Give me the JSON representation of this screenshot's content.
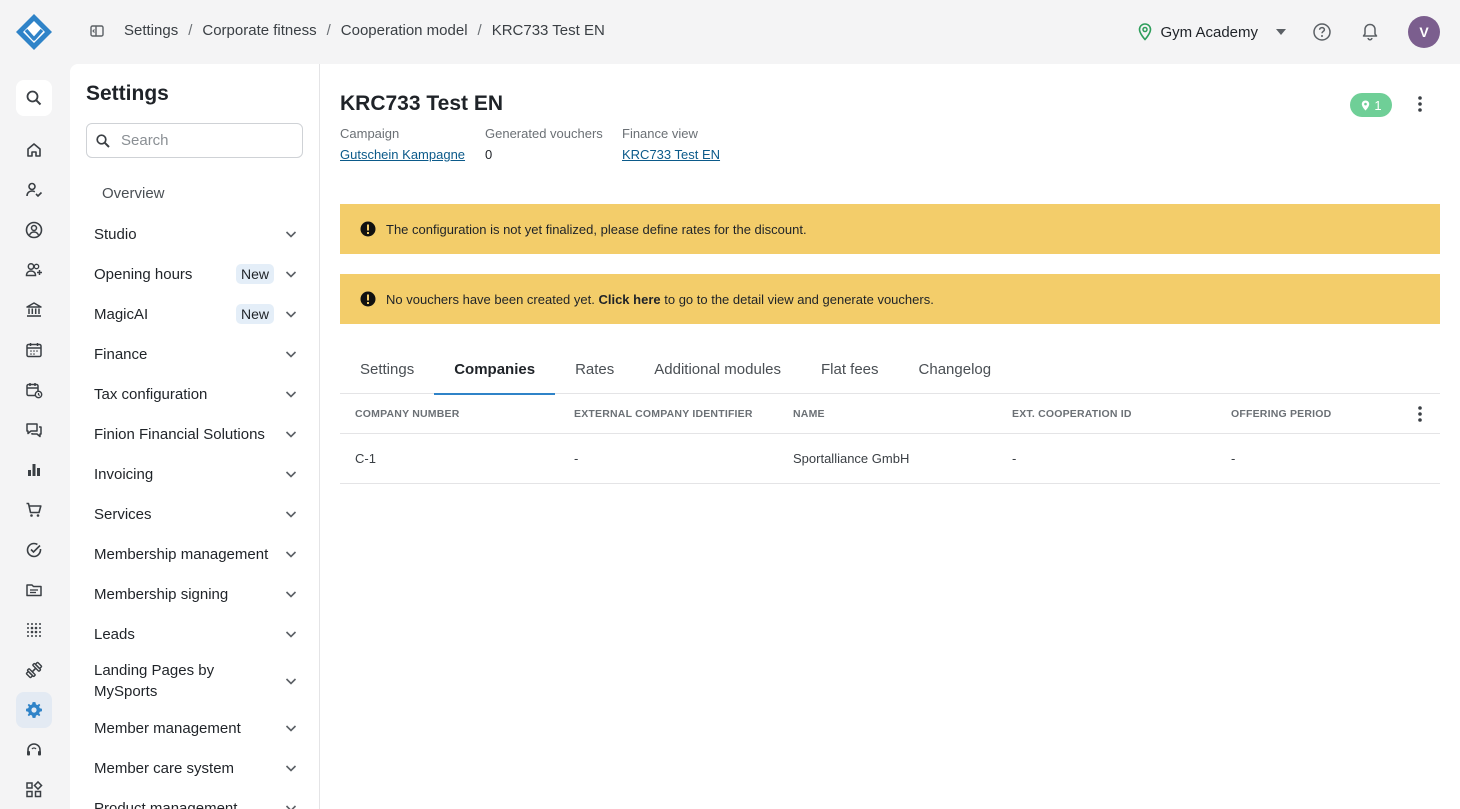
{
  "breadcrumb": [
    "Settings",
    "Corporate fitness",
    "Cooperation model",
    "KRC733 Test EN"
  ],
  "topbar": {
    "studio": "Gym Academy",
    "avatar_initial": "V"
  },
  "settings": {
    "title": "Settings",
    "search_placeholder": "Search",
    "overview": "Overview",
    "items": [
      {
        "label": "Studio"
      },
      {
        "label": "Opening hours",
        "badge": "New"
      },
      {
        "label": "MagicAI",
        "badge": "New"
      },
      {
        "label": "Finance"
      },
      {
        "label": "Tax configuration"
      },
      {
        "label": "Finion Financial Solutions"
      },
      {
        "label": "Invoicing"
      },
      {
        "label": "Services"
      },
      {
        "label": "Membership management"
      },
      {
        "label": "Membership signing"
      },
      {
        "label": "Leads"
      },
      {
        "label": "Landing Pages by MySports"
      },
      {
        "label": "Member management"
      },
      {
        "label": "Member care system"
      },
      {
        "label": "Product management"
      }
    ]
  },
  "page": {
    "title": "KRC733 Test EN",
    "location_count": "1",
    "meta": {
      "campaign_label": "Campaign",
      "campaign_value": "Gutschein Kampagne",
      "vouchers_label": "Generated vouchers",
      "vouchers_value": "0",
      "finance_label": "Finance view",
      "finance_value": "KRC733 Test EN"
    },
    "alerts": {
      "config": "The configuration is not yet finalized, please define rates for the discount.",
      "vouchers_prefix": "No vouchers have been created yet. ",
      "vouchers_link": "Click here",
      "vouchers_suffix": " to go to the detail view and generate vouchers."
    },
    "tabs": [
      "Settings",
      "Companies",
      "Rates",
      "Additional modules",
      "Flat fees",
      "Changelog"
    ],
    "active_tab": "Companies",
    "table": {
      "columns": [
        "Company number",
        "External company identifier",
        "Name",
        "Ext. cooperation ID",
        "Offering period"
      ],
      "rows": [
        [
          "C-1",
          "-",
          "Sportalliance GmbH",
          "-",
          "-"
        ]
      ]
    }
  },
  "colors": {
    "accent": "#2f83c8",
    "alert": "#f3cd6a",
    "badge_green": "#6fcf97",
    "avatar": "#7b5e8e"
  }
}
